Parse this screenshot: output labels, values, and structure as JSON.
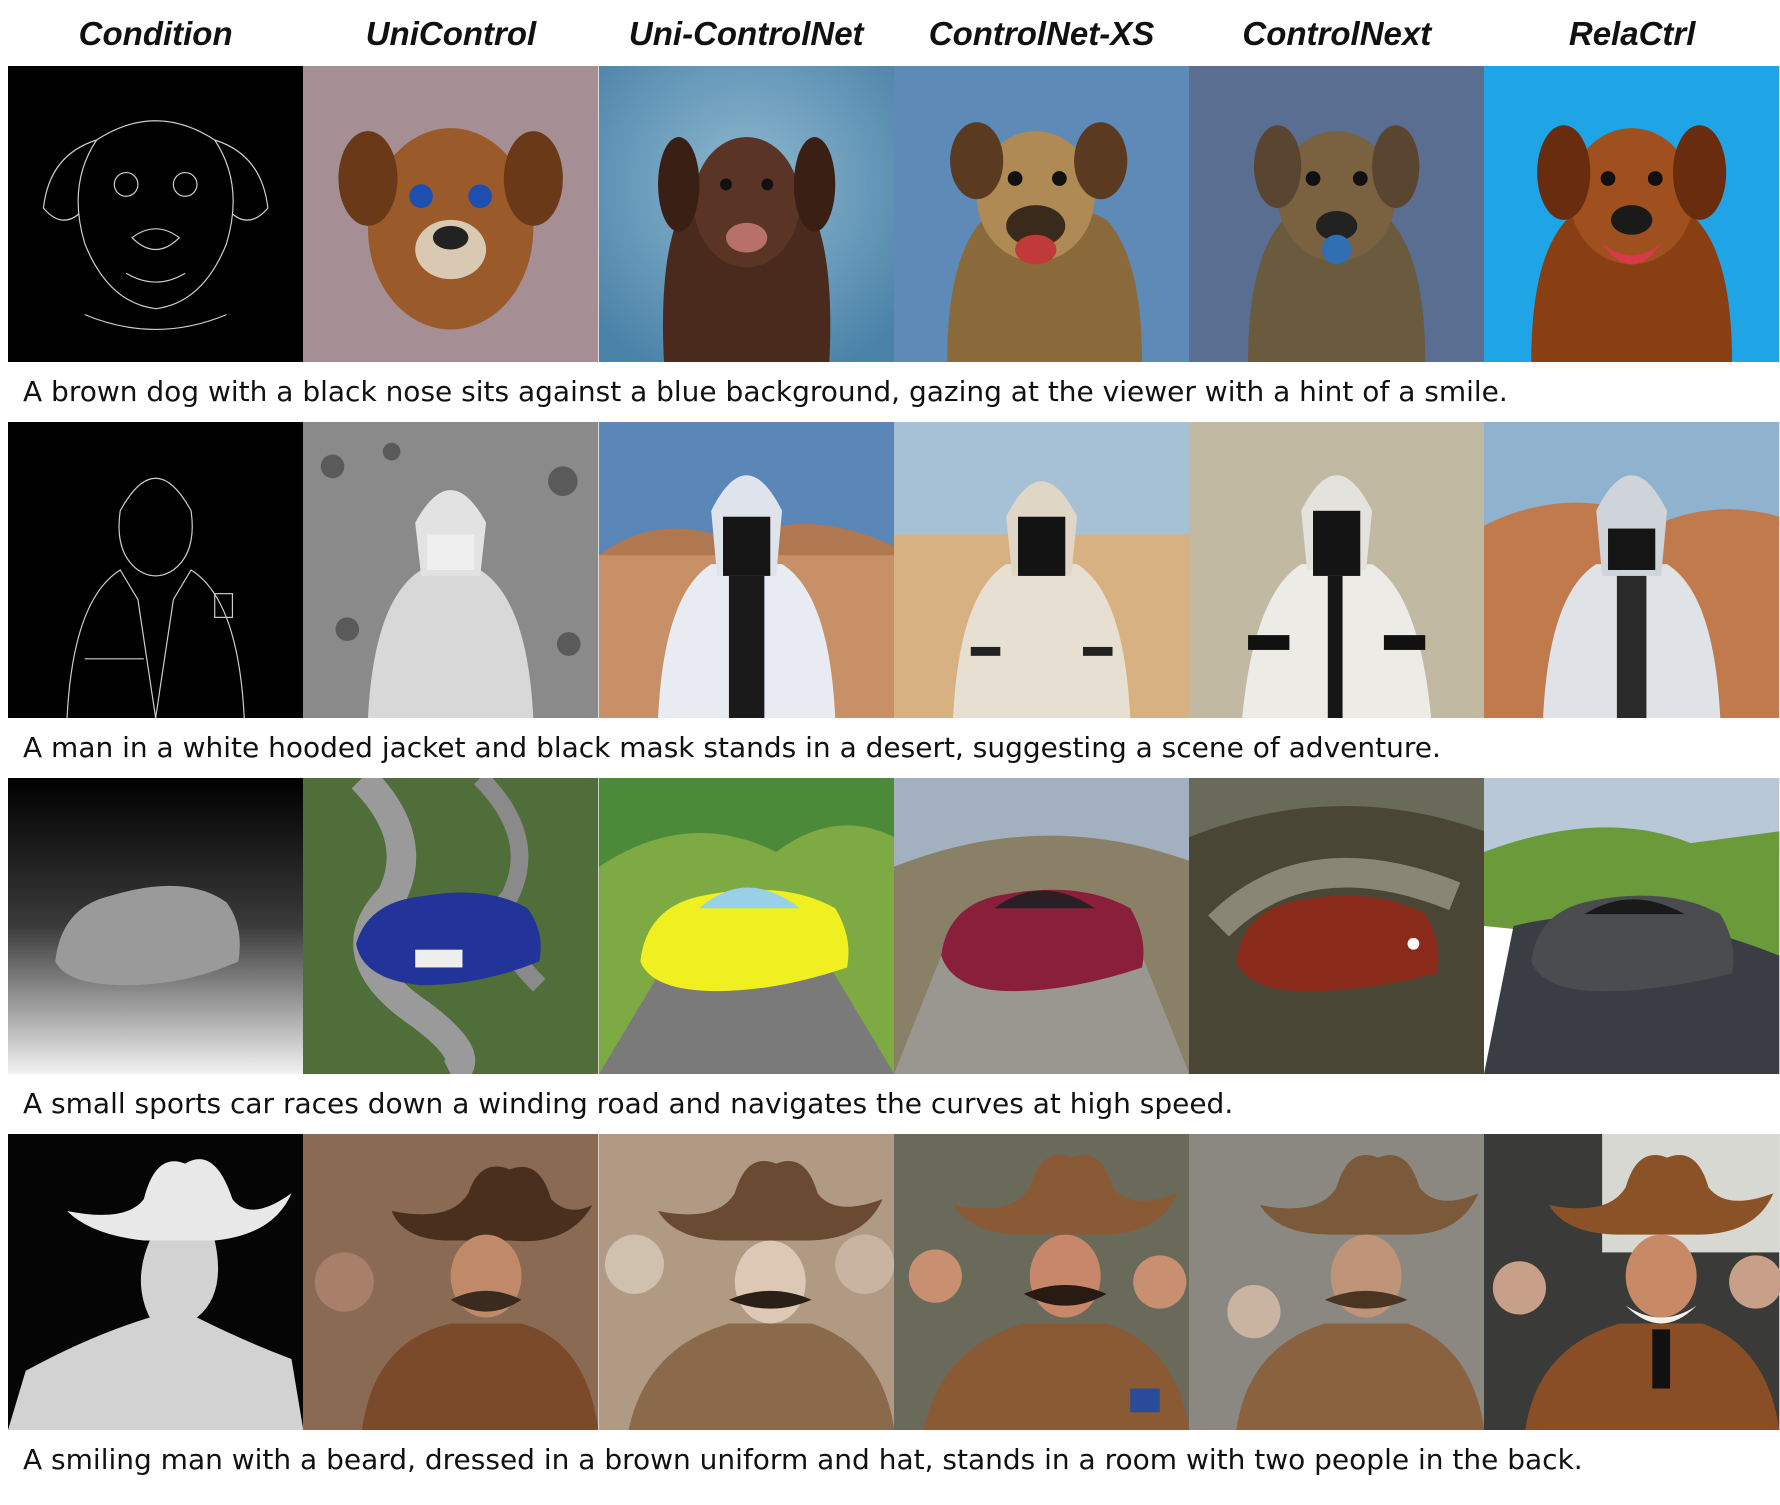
{
  "columns": [
    "Condition",
    "UniControl",
    "Uni-ControlNet",
    "ControlNet-XS",
    "ControlNext",
    "RelaCtrl"
  ],
  "rows": [
    {
      "caption": "A brown dog with a black nose sits against a blue background, gazing at the viewer with a hint of a smile."
    },
    {
      "caption": "A man in a white hooded jacket and black mask stands in a desert, suggesting a scene of adventure."
    },
    {
      "caption": "A small sports car races down a winding road and navigates the curves at high speed."
    },
    {
      "caption": "A smiling man with a beard, dressed in a brown uniform and hat, stands in a room with two people in the back."
    }
  ]
}
